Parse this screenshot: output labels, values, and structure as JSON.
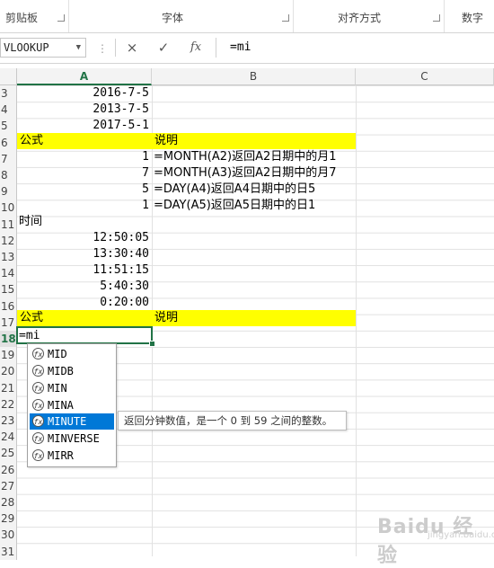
{
  "ribbon": {
    "groups": [
      "剪贴板",
      "字体",
      "对齐方式",
      "数字"
    ]
  },
  "formula_bar": {
    "name_box": "VLOOKUP",
    "cancel_icon": "×",
    "enter_icon": "✓",
    "fx_icon": "fx",
    "formula": "=mi"
  },
  "columns": [
    "A",
    "B",
    "C"
  ],
  "rows": [
    "3",
    "4",
    "5",
    "6",
    "7",
    "8",
    "9",
    "10",
    "11",
    "12",
    "13",
    "14",
    "15",
    "16",
    "17",
    "18",
    "19",
    "20",
    "21",
    "22",
    "23",
    "24",
    "25",
    "26",
    "27",
    "28",
    "29",
    "30",
    "31"
  ],
  "cells": {
    "A3": "2016-7-5",
    "A4": "2013-7-5",
    "A5": "2017-5-1",
    "A6": "公式",
    "B6": "说明",
    "A7": "1",
    "B7": "=MONTH(A2)返回A2日期中的月1",
    "A8": "7",
    "B8": "=MONTH(A3)返回A2日期中的月7",
    "A9": "5",
    "B9": "=DAY(A4)返回A4日期中的日5",
    "A10": "1",
    "B10": "=DAY(A5)返回A5日期中的日1",
    "A11": "时间",
    "A12": "12:50:05",
    "A13": "13:30:40",
    "A14": "11:51:15",
    "A15": "5:40:30",
    "A16": "0:20:00",
    "A17": "公式",
    "B17": "说明",
    "A18": "=mi"
  },
  "autocomplete": {
    "items": [
      "MID",
      "MIDB",
      "MIN",
      "MINA",
      "MINUTE",
      "MINVERSE",
      "MIRR"
    ],
    "selected": "MINUTE",
    "tooltip": "返回分钟数值，是一个 0 到 59 之间的整数。"
  },
  "colors": {
    "highlight": "#ffff00",
    "selection": "#217346",
    "accent": "#0078d7"
  },
  "watermark": {
    "text": "Baidu 经验",
    "sub": "jingyan.baidu.com"
  }
}
